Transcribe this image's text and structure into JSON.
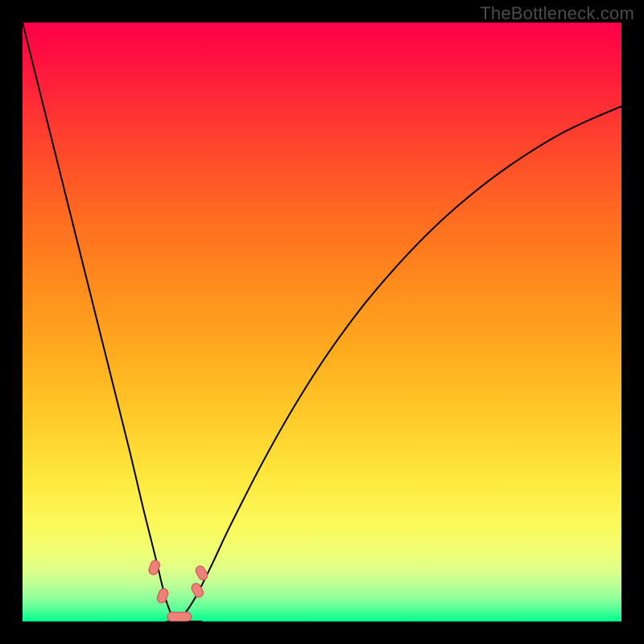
{
  "domain": "Chart",
  "watermark": "TheBottleneck.com",
  "colors": {
    "background_black": "#000000",
    "watermark_grey": "#4b4b4b",
    "curve_black": "#000000",
    "marker_stroke": "#d15b5f",
    "marker_fill": "#ee827a",
    "gradient_stops": [
      {
        "offset": 0.0,
        "color": "#ff0049"
      },
      {
        "offset": 0.07,
        "color": "#ff143f"
      },
      {
        "offset": 0.15,
        "color": "#ff3233"
      },
      {
        "offset": 0.24,
        "color": "#ff5128"
      },
      {
        "offset": 0.34,
        "color": "#ff7020"
      },
      {
        "offset": 0.45,
        "color": "#ff8f1d"
      },
      {
        "offset": 0.56,
        "color": "#ffae1f"
      },
      {
        "offset": 0.67,
        "color": "#ffce2a"
      },
      {
        "offset": 0.76,
        "color": "#ffe83d"
      },
      {
        "offset": 0.84,
        "color": "#fbf95b"
      },
      {
        "offset": 0.885,
        "color": "#efff74"
      },
      {
        "offset": 0.915,
        "color": "#ddff88"
      },
      {
        "offset": 0.935,
        "color": "#c2ff95"
      },
      {
        "offset": 0.955,
        "color": "#9cff9b"
      },
      {
        "offset": 0.975,
        "color": "#67ff99"
      },
      {
        "offset": 1.0,
        "color": "#00ff90"
      }
    ]
  },
  "chart_data": {
    "type": "line",
    "title": "",
    "xlabel": "",
    "ylabel": "",
    "xlim": [
      0,
      100
    ],
    "ylim": [
      0,
      100
    ],
    "axes_visible": false,
    "description": "Two black curves over a vertical red→green gradient; both dip to y≈0 near x≈25. A few small rounded-pill markers sit in that valley.",
    "series": [
      {
        "name": "curve-left",
        "x": [
          0.0,
          2.0,
          4.0,
          6.0,
          8.0,
          10.0,
          12.0,
          14.0,
          16.0,
          18.0,
          20.0,
          21.5,
          22.5,
          23.2,
          23.8,
          24.2,
          25.0,
          25.8,
          26.6,
          27.4,
          28.2,
          29.0,
          30.0
        ],
        "y": [
          100.0,
          92.0,
          84.0,
          76.0,
          68.0,
          60.0,
          52.0,
          44.0,
          36.0,
          28.0,
          19.5,
          13.5,
          9.5,
          6.5,
          4.2,
          2.8,
          0.9,
          0.1,
          0.0,
          0.0,
          0.0,
          0.0,
          0.0
        ]
      },
      {
        "name": "curve-right",
        "x": [
          24.0,
          25.0,
          26.0,
          27.0,
          28.5,
          30.0,
          32.0,
          34.0,
          37.0,
          40.0,
          44.0,
          48.0,
          52.0,
          57.0,
          62.0,
          67.0,
          72.0,
          78.0,
          84.0,
          90.0,
          95.0,
          100.0
        ],
        "y": [
          0.0,
          0.0,
          0.2,
          1.2,
          3.4,
          6.2,
          10.3,
          14.6,
          20.6,
          26.4,
          33.6,
          40.2,
          46.2,
          52.9,
          58.8,
          64.1,
          68.8,
          73.7,
          77.9,
          81.5,
          83.9,
          86.0
        ]
      }
    ],
    "markers": [
      {
        "name": "marker-left-upper",
        "x": 22.0,
        "y": 9.0,
        "angle_deg": -70,
        "length": 2.4
      },
      {
        "name": "marker-left-lower",
        "x": 23.4,
        "y": 4.3,
        "angle_deg": -70,
        "length": 2.4
      },
      {
        "name": "marker-right-lower",
        "x": 29.2,
        "y": 5.2,
        "angle_deg": 62,
        "length": 2.4
      },
      {
        "name": "marker-right-upper",
        "x": 29.9,
        "y": 8.1,
        "angle_deg": 62,
        "length": 2.4
      },
      {
        "name": "marker-bottom",
        "x": 26.2,
        "y": 0.8,
        "angle_deg": 0,
        "length": 4.0
      }
    ]
  }
}
